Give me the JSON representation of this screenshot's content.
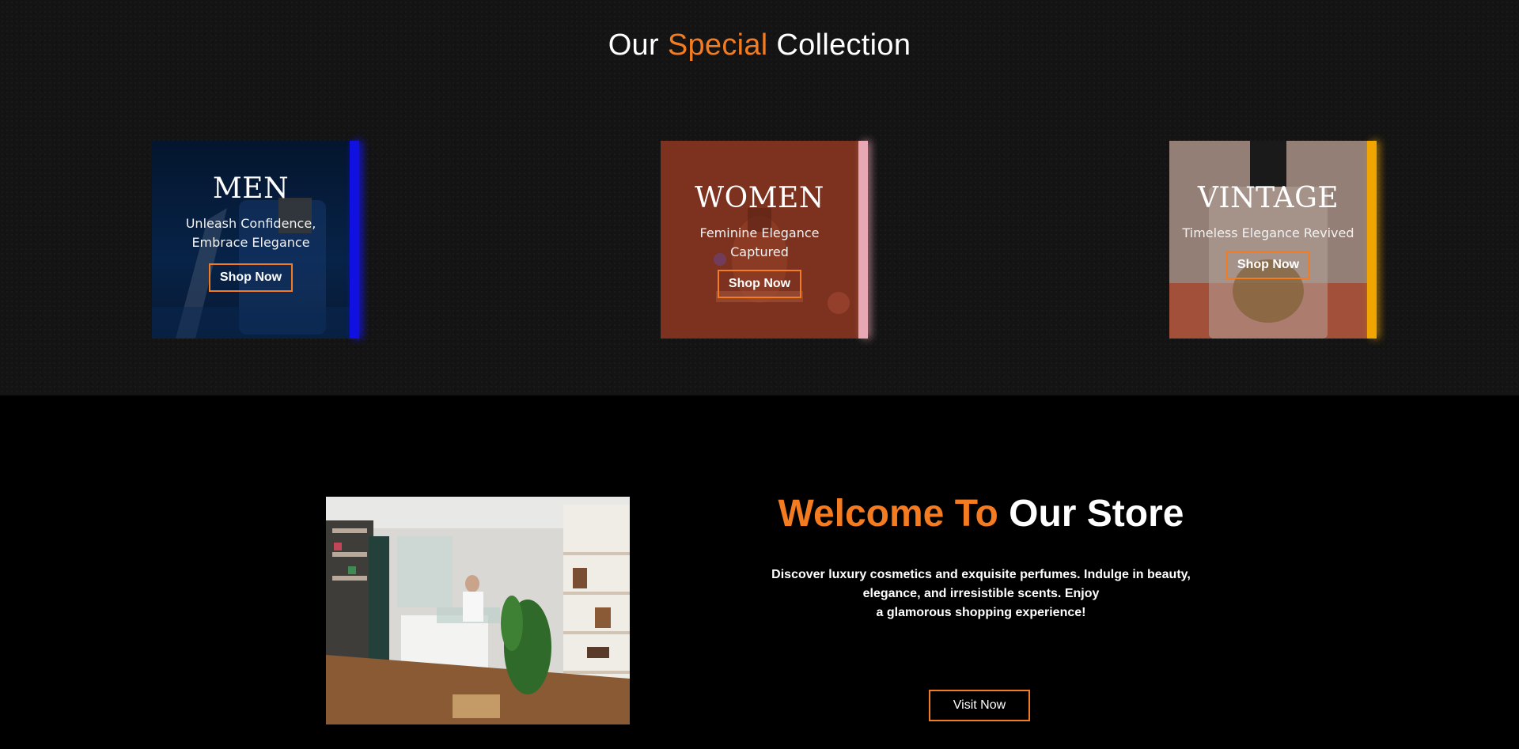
{
  "collection": {
    "title_pre": "Our ",
    "title_accent": "Special",
    "title_post": " Collection",
    "cards": [
      {
        "title": "MEN",
        "subtitle": "Unleash Confidence, Embrace Elegance",
        "button": "Shop Now",
        "edge_color": "#1010e0"
      },
      {
        "title": "WOMEN",
        "subtitle": "Feminine Elegance Captured",
        "button": "Shop Now",
        "edge_color": "#e8a7b4"
      },
      {
        "title": "VINTAGE",
        "subtitle": "Timeless Elegance Revived",
        "button": "Shop Now",
        "edge_color": "#f0a500"
      }
    ]
  },
  "store": {
    "title_accent": "Welcome To",
    "title_rest": " Our Store",
    "text_line1": "Discover luxury cosmetics and exquisite perfumes. Indulge in beauty,",
    "text_line2": "elegance, and irresistible scents. Enjoy",
    "text_line3": "a glamorous shopping experience!",
    "button": "Visit Now"
  },
  "colors": {
    "accent": "#f47b20",
    "background_top": "#141414",
    "background_bottom": "#000000"
  }
}
